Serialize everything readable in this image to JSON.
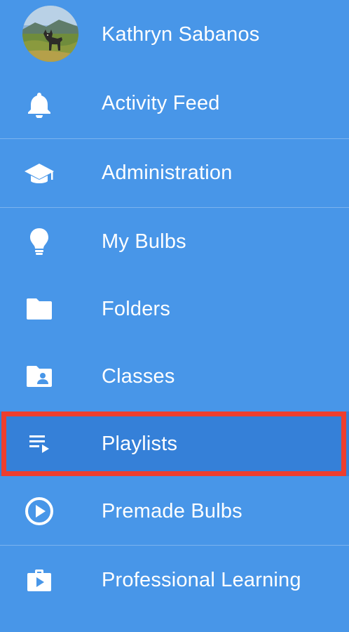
{
  "profile": {
    "name": "Kathryn Sabanos",
    "avatar_icon": "user-avatar-photo"
  },
  "nav_items": [
    {
      "label": "Activity Feed",
      "icon": "bell-icon"
    },
    {
      "label": "Administration",
      "icon": "graduation-cap-icon"
    },
    {
      "label": "My Bulbs",
      "icon": "lightbulb-icon"
    },
    {
      "label": "Folders",
      "icon": "folder-icon"
    },
    {
      "label": "Classes",
      "icon": "folder-person-icon"
    },
    {
      "label": "Playlists",
      "icon": "playlist-icon",
      "selected": true
    },
    {
      "label": "Premade Bulbs",
      "icon": "play-circle-icon"
    },
    {
      "label": "Professional Learning",
      "icon": "briefcase-play-icon"
    }
  ],
  "colors": {
    "background": "#4896E8",
    "selected_background": "#3580D8",
    "highlight_border": "#EE3E2E",
    "text": "#FFFFFF"
  }
}
